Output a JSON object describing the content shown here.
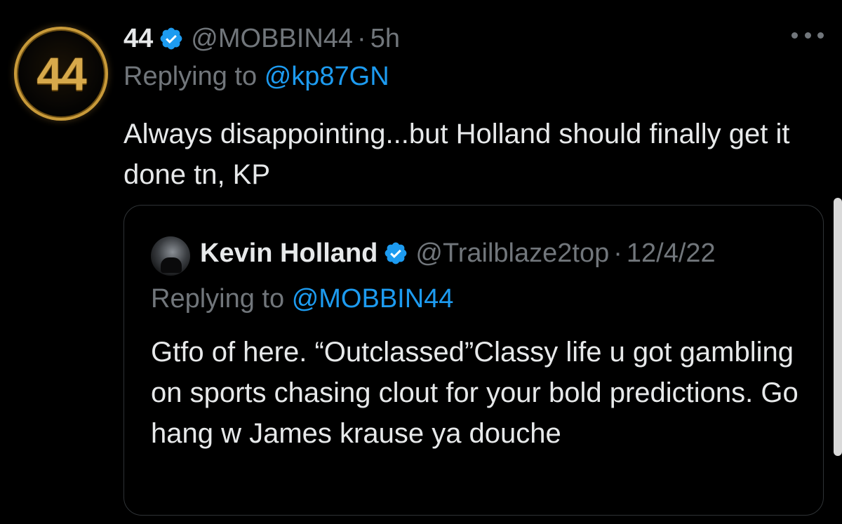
{
  "tweet": {
    "avatar_text": "44",
    "display_name": "44",
    "handle": "@MOBBIN44",
    "separator": "·",
    "time": "5h",
    "replying_prefix": "Replying to",
    "replying_to": "@kp87GN",
    "text": "Always disappointing...but Holland should finally get it done tn, KP"
  },
  "quote": {
    "display_name": "Kevin Holland",
    "handle": "@Trailblaze2top",
    "separator": "·",
    "date": "12/4/22",
    "replying_prefix": "Replying to",
    "replying_to": "@MOBBIN44",
    "text": "Gtfo of here.  “Outclassed”Classy life u got gambling on sports chasing clout for your bold predictions. Go hang w James krause ya douche"
  },
  "icons": {
    "verified": "verified-badge-icon",
    "more": "more-options-icon"
  },
  "colors": {
    "background": "#000000",
    "text": "#e7e9ea",
    "muted": "#71767b",
    "link": "#1d9bf0",
    "verified": "#1d9bf0",
    "avatar_gold": "#d7a94b"
  }
}
